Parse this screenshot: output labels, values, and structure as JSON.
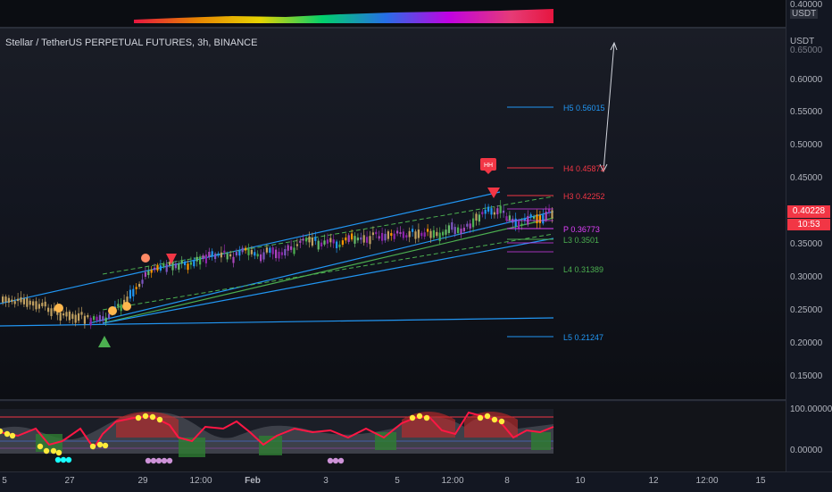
{
  "chart_title": "Stellar / TetherUS PERPETUAL FUTURES, 3h, BINANCE",
  "top_pane": {
    "price_label": "0.40000",
    "currency_label": "USDT"
  },
  "price_axis": {
    "currency": "USDT",
    "top_label": "0.65000",
    "ticks": [
      "0.60000",
      "0.55000",
      "0.50000",
      "0.45000",
      "0.40000",
      "0.35000",
      "0.30000",
      "0.25000",
      "0.20000",
      "0.15000"
    ]
  },
  "current_price": {
    "value": "0.40228",
    "countdown": "10:53",
    "color": "#f23645"
  },
  "oscillator_axis": {
    "top": "100.00000",
    "bottom": "0.00000"
  },
  "time_axis": [
    "5",
    "27",
    "29",
    "12:00",
    "Feb",
    "3",
    "5",
    "12:00",
    "8",
    "10",
    "12",
    "12:00",
    "15"
  ],
  "pivot_levels": [
    {
      "label": "H5 0.56015",
      "color": "#2196f3"
    },
    {
      "label": "H4 0.45873",
      "color": "#f23645"
    },
    {
      "label": "H3 0.42252",
      "color": "#f23645"
    },
    {
      "label": "P 0.36773",
      "color": "#e040fb"
    },
    {
      "label": "L3 0.3501",
      "color": "#4caf50"
    },
    {
      "label": "L4 0.31389",
      "color": "#4caf50"
    },
    {
      "label": "L5 0.21247",
      "color": "#2196f3"
    }
  ],
  "markers": {
    "hh_label": "HH"
  },
  "colors": {
    "channel": "#2196f3",
    "midline": "#4caf50",
    "bull": "#4caf50",
    "bear": "#f23645"
  }
}
